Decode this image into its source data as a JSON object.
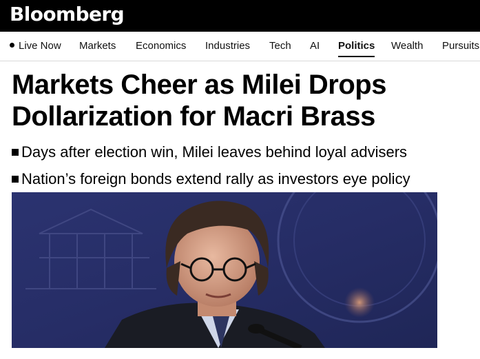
{
  "header": {
    "logo": "Bloomberg"
  },
  "nav": {
    "live_label": "Live Now",
    "items": [
      {
        "label": "Markets"
      },
      {
        "label": "Economics"
      },
      {
        "label": "Industries"
      },
      {
        "label": "Tech"
      },
      {
        "label": "AI"
      },
      {
        "label": "Politics",
        "active": true
      },
      {
        "label": "Wealth"
      },
      {
        "label": "Pursuits"
      }
    ]
  },
  "article": {
    "headline_line1": "Markets Cheer as Milei Drops",
    "headline_line2": "Dollarization for Macri Brass",
    "bullets": [
      "Days after election win, Milei leaves behind loyal advisers",
      "Nation’s foreign bonds extend rally as investors eye policy"
    ],
    "image": {
      "subject": "portrait-photo",
      "accent_color": "#2d3470"
    }
  }
}
